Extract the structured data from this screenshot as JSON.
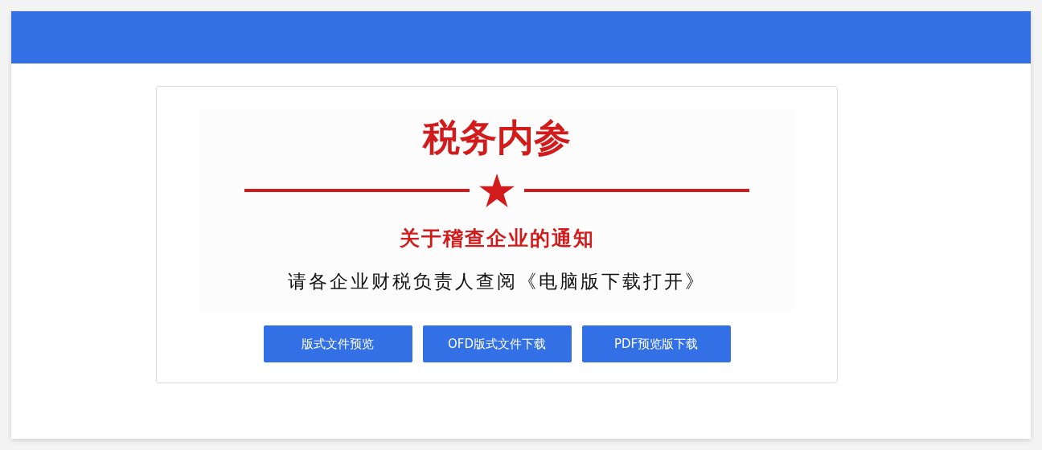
{
  "notice": {
    "title": "税务内参",
    "subtitle": "关于稽查企业的通知",
    "message": "请各企业财税负责人查阅《电脑版下载打开》"
  },
  "buttons": [
    "版式文件预览",
    "OFD版式文件下载",
    "PDF预览版下载"
  ]
}
